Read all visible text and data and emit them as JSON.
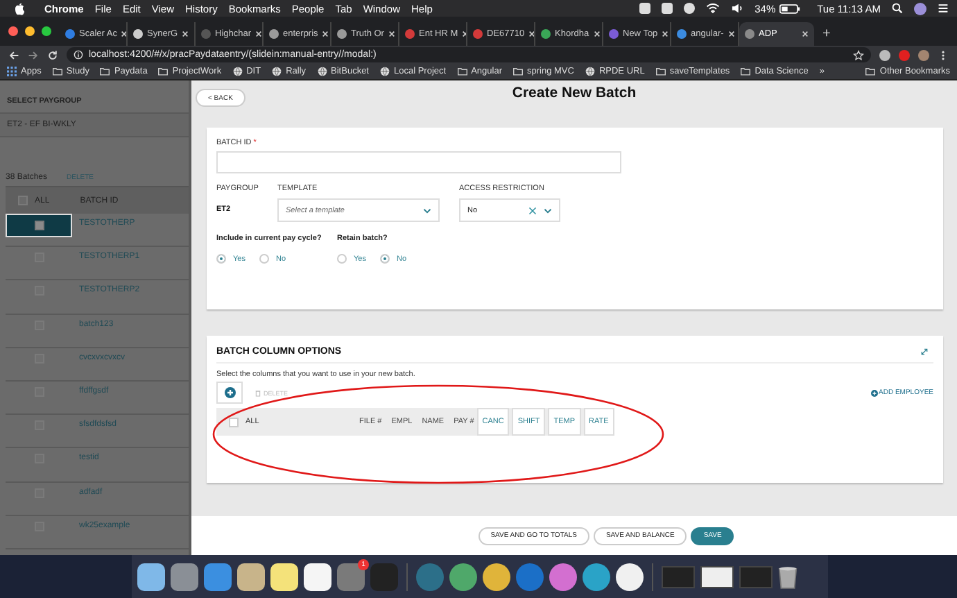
{
  "menu_bar": {
    "app": "Chrome",
    "menus": [
      "File",
      "Edit",
      "View",
      "History",
      "Bookmarks",
      "People",
      "Tab",
      "Window",
      "Help"
    ],
    "battery": "34%",
    "clock": "Tue 11:13 AM"
  },
  "browser": {
    "tabs": [
      {
        "title": "Scaler Ac",
        "color": "#2f7de1",
        "selected": false
      },
      {
        "title": "SynerG",
        "color": "#cccccc",
        "selected": false
      },
      {
        "title": "Highchar",
        "color": "#555555",
        "selected": false
      },
      {
        "title": "enterpris",
        "color": "#9a9a9a",
        "selected": false
      },
      {
        "title": "Truth Or",
        "color": "#9a9a9a",
        "selected": false
      },
      {
        "title": "Ent HR M",
        "color": "#d33a3a",
        "selected": false
      },
      {
        "title": "DE67710",
        "color": "#d33a3a",
        "selected": false
      },
      {
        "title": "Khordha",
        "color": "#3aa657",
        "selected": false
      },
      {
        "title": "New Top",
        "color": "#7b5cd6",
        "selected": false
      },
      {
        "title": "angular-",
        "color": "#3b8be0",
        "selected": false
      },
      {
        "title": "ADP",
        "color": "#8a8a8a",
        "selected": true
      }
    ],
    "new_tab": "+",
    "url": "localhost:4200/#/x/pracPaydataentry/(slidein:manual-entry//modal:)",
    "bookmarks": [
      {
        "label": "Apps",
        "kind": "apps"
      },
      {
        "label": "Study",
        "kind": "folder"
      },
      {
        "label": "Paydata",
        "kind": "folder"
      },
      {
        "label": "ProjectWork",
        "kind": "folder"
      },
      {
        "label": "DIT",
        "kind": "site"
      },
      {
        "label": "Rally",
        "kind": "site"
      },
      {
        "label": "BitBucket",
        "kind": "site"
      },
      {
        "label": "Local Project",
        "kind": "site"
      },
      {
        "label": "Angular",
        "kind": "folder"
      },
      {
        "label": "spring MVC",
        "kind": "folder"
      },
      {
        "label": "RPDE URL",
        "kind": "site"
      },
      {
        "label": "saveTemplates",
        "kind": "folder"
      },
      {
        "label": "Data Science",
        "kind": "folder"
      }
    ],
    "more": "»",
    "other_bookmarks": "Other Bookmarks"
  },
  "sidebar": {
    "heading": "SELECT PAYGROUP",
    "paygroup": "ET2 - EF BI-WKLY",
    "count": "38 Batches",
    "delete": "DELETE",
    "all_checked": false,
    "columns": [
      "ALL",
      "BATCH ID"
    ],
    "rows": [
      {
        "batch_id": "TESTOTHERP",
        "selected": true
      },
      {
        "batch_id": "TESTOTHERP1",
        "selected": false
      },
      {
        "batch_id": "TESTOTHERP2",
        "selected": false
      },
      {
        "batch_id": "batch123",
        "selected": false
      },
      {
        "batch_id": "cvcxvxcvxcv",
        "selected": false
      },
      {
        "batch_id": "ffdffgsdf",
        "selected": false
      },
      {
        "batch_id": "sfsdfdsfsd",
        "selected": false
      },
      {
        "batch_id": "testid",
        "selected": false
      },
      {
        "batch_id": "adfadf",
        "selected": false
      },
      {
        "batch_id": "wk25example",
        "selected": false
      }
    ]
  },
  "modal": {
    "back": "< BACK",
    "title": "Create New Batch",
    "batch_id": {
      "label": "BATCH ID",
      "required_mark": "*"
    },
    "paygroup": {
      "label": "PAYGROUP",
      "value": "ET2"
    },
    "template": {
      "label": "TEMPLATE",
      "placeholder": "Select a template"
    },
    "access_restriction": {
      "label": "ACCESS RESTRICTION",
      "value": "No"
    },
    "include_current": {
      "label": "Include in current pay cycle?",
      "options": [
        {
          "label": "Yes",
          "selected": true
        },
        {
          "label": "No",
          "selected": false
        }
      ]
    },
    "retain": {
      "label": "Retain batch?",
      "options": [
        {
          "label": "Yes",
          "selected": false
        },
        {
          "label": "No",
          "selected": true
        }
      ]
    },
    "column_options": {
      "title": "BATCH COLUMN OPTIONS",
      "hint": "Select the columns that you want to use in your new batch.",
      "delete": "DELETE",
      "add_employee": "ADD EMPLOYEE",
      "all": "ALL",
      "all_checked": false,
      "columns": [
        {
          "label": "FILE #",
          "kind": "plain"
        },
        {
          "label": "EMPL",
          "kind": "plain"
        },
        {
          "label": "NAME",
          "kind": "plain"
        },
        {
          "label": "PAY #",
          "kind": "plain"
        },
        {
          "label": "CANC",
          "kind": "chip"
        },
        {
          "label": "SHIFT",
          "kind": "chip"
        },
        {
          "label": "TEMP",
          "kind": "chip"
        },
        {
          "label": "RATE",
          "kind": "chip"
        }
      ]
    },
    "buttons": [
      {
        "label": "SAVE AND GO TO TOTALS",
        "kind": "secondary"
      },
      {
        "label": "SAVE AND BALANCE",
        "kind": "secondary"
      },
      {
        "label": "SAVE",
        "kind": "primary"
      }
    ]
  },
  "dock": {
    "badge": "1"
  }
}
